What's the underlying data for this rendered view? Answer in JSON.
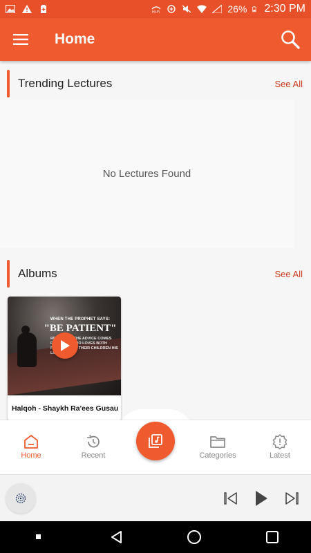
{
  "status_bar": {
    "time": "2:30 PM",
    "battery": "26%",
    "icons": [
      "image-icon",
      "warning-icon",
      "battery-saver-icon",
      "hd-wifi-icon",
      "data-saver-icon",
      "mute-icon",
      "wifi-icon",
      "signal-icon",
      "battery-icon"
    ]
  },
  "app_bar": {
    "title": "Home",
    "menu_icon": "hamburger-icon",
    "search_icon": "search-icon"
  },
  "sections": {
    "trending": {
      "title": "Trending Lectures",
      "see_all": "See All",
      "empty_message": "No Lectures Found"
    },
    "albums": {
      "title": "Albums",
      "see_all": "See All",
      "items": [
        {
          "title": "Halqoh - Shaykh Ra'ees Gusau",
          "art_text_small": "WHEN THE PROPHET SAYS:",
          "art_text_big": "\"BE PATIENT\"",
          "art_text_body": "REMEMBER THE ADVICE COMES FROM ONE WHO LOVES BOTH PARENTS AND THEIR CHILDREN HIS LIFE."
        }
      ]
    }
  },
  "bottom_nav": {
    "items": [
      {
        "label": "Home",
        "icon": "home-icon",
        "active": true
      },
      {
        "label": "Recent",
        "icon": "history-icon",
        "active": false
      },
      {
        "label": "Categories",
        "icon": "folder-icon",
        "active": false
      },
      {
        "label": "Latest",
        "icon": "badge-icon",
        "active": false
      }
    ],
    "fab_icon": "music-library-icon"
  },
  "player": {
    "art_icon": "vinyl-icon",
    "controls": [
      "skip-previous-icon",
      "play-icon",
      "skip-next-icon"
    ]
  },
  "system_nav": {
    "buttons": [
      "recents-dot-icon",
      "back-icon",
      "home-circle-icon",
      "overview-square-icon"
    ]
  },
  "colors": {
    "primary": "#ef5a2e",
    "status_bar": "#e8502a",
    "accent_text": "#c8391b",
    "inactive_nav": "#888888"
  }
}
